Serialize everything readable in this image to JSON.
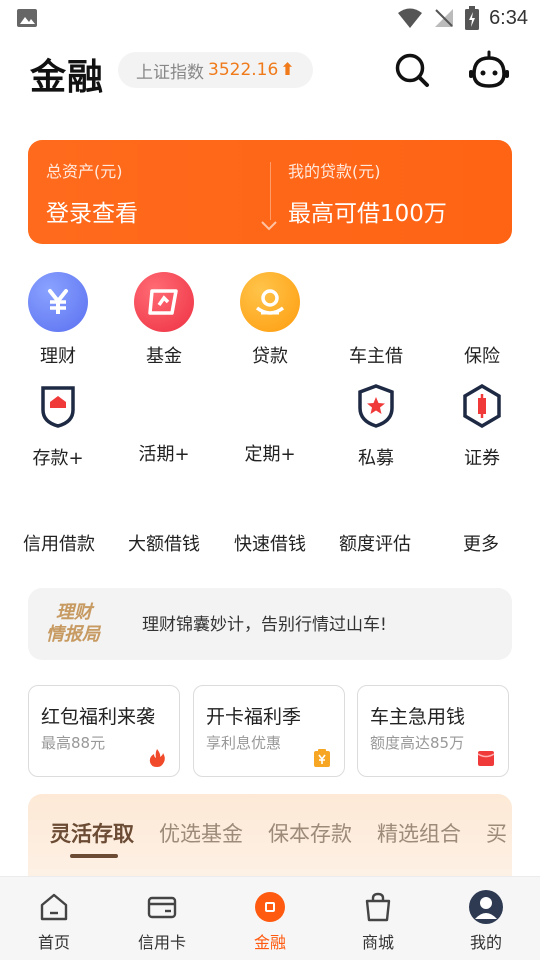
{
  "status_bar": {
    "time": "6:34"
  },
  "header": {
    "title": "金融",
    "index_label": "上证指数",
    "index_value": "3522.16",
    "index_arrow": "⬆"
  },
  "asset_card": {
    "assets_label": "总资产(元)",
    "assets_action": "登录查看",
    "loan_label": "我的贷款(元)",
    "loan_value": "最高可借100万"
  },
  "grid": {
    "row1": [
      {
        "label": "理财",
        "icon": "yuan-icon",
        "color": "#5d7cf5"
      },
      {
        "label": "基金",
        "icon": "fund-icon",
        "color": "#f2404f"
      },
      {
        "label": "贷款",
        "icon": "loan-icon",
        "color": "#ffa11a"
      },
      {
        "label": "车主借",
        "icon": "",
        "color": ""
      },
      {
        "label": "保险",
        "icon": "",
        "color": ""
      }
    ],
    "row2": [
      {
        "label": "存款+",
        "icon": "deposit-shield-icon"
      },
      {
        "label": "活期+",
        "icon": ""
      },
      {
        "label": "定期+",
        "icon": ""
      },
      {
        "label": "私募",
        "icon": "private-equity-shield-icon"
      },
      {
        "label": "证券",
        "icon": "securities-hexagon-icon"
      }
    ]
  },
  "loan_links": [
    "信用借款",
    "大额借钱",
    "快速借钱",
    "额度评估",
    "更多"
  ],
  "news": {
    "badge_line1": "理财",
    "badge_line2": "情报局",
    "text": "理财锦囊妙计，告别行情过山车!"
  },
  "promos": [
    {
      "title": "红包福利来袭",
      "subtitle": "最高88元",
      "icon": "flame-icon",
      "color": "#f04a2a"
    },
    {
      "title": "开卡福利季",
      "subtitle": "享利息优惠",
      "icon": "yuan-tag-icon",
      "color": "#f6a623"
    },
    {
      "title": "车主急用钱",
      "subtitle": "额度高达85万",
      "icon": "red-envelope-icon",
      "color": "#f03a3a"
    }
  ],
  "product_tabs": [
    "灵活存取",
    "优选基金",
    "保本存款",
    "精选组合",
    "买"
  ],
  "bottom_nav": [
    {
      "label": "首页",
      "icon": "home-icon"
    },
    {
      "label": "信用卡",
      "icon": "card-icon"
    },
    {
      "label": "金融",
      "icon": "finance-icon"
    },
    {
      "label": "商城",
      "icon": "shopping-bag-icon"
    },
    {
      "label": "我的",
      "icon": "avatar-icon"
    }
  ],
  "colors": {
    "accent": "#ff6414",
    "active_nav": "#ff5a10"
  }
}
